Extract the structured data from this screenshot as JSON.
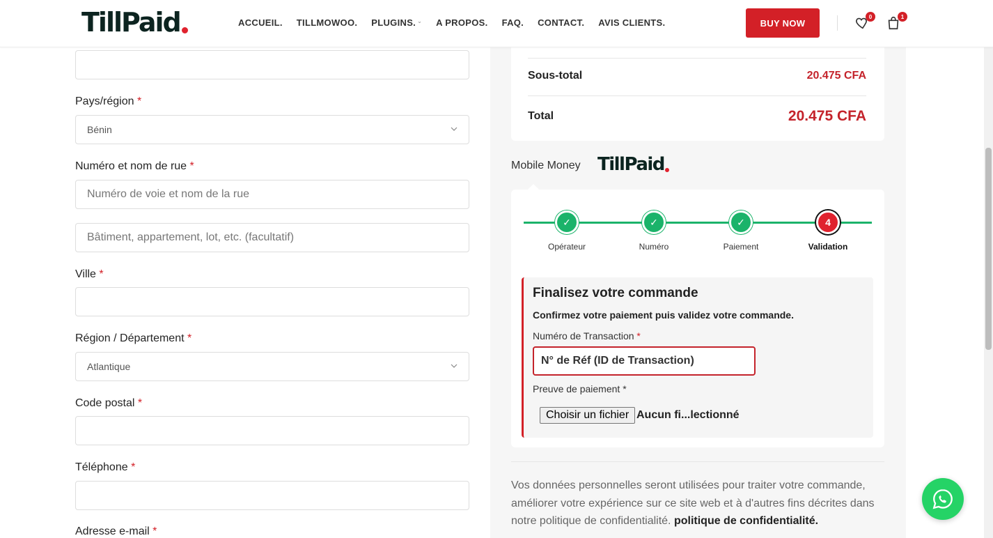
{
  "brand": {
    "logo_text": "TillPaid",
    "accent": "#d32027"
  },
  "nav": {
    "items": [
      "ACCUEIL.",
      "TILLMOWOO.",
      "PLUGINS.",
      "A PROPOS.",
      "FAQ.",
      "CONTACT.",
      "AVIS CLIENTS."
    ],
    "buy_label": "BUY NOW",
    "wishlist_count": "0",
    "cart_count": "1"
  },
  "form": {
    "country_label": "Pays/région",
    "country_value": "Bénin",
    "street_label": "Numéro et nom de rue",
    "street_placeholder": "Numéro de voie et nom de la rue",
    "street2_placeholder": "Bâtiment, appartement, lot, etc. (facultatif)",
    "city_label": "Ville",
    "region_label": "Région / Département",
    "region_value": "Atlantique",
    "postal_label": "Code postal",
    "phone_label": "Téléphone",
    "email_label": "Adresse e-mail",
    "required_mark": "*"
  },
  "summary": {
    "subtotal_label": "Sous-total",
    "subtotal_value": "20.475 CFA",
    "total_label": "Total",
    "total_value": "20.475 CFA"
  },
  "payment": {
    "method_label": "Mobile Money",
    "logo_text": "TillPaid",
    "steps": [
      {
        "label": "Opérateur",
        "mark": "✓"
      },
      {
        "label": "Numéro",
        "mark": "✓"
      },
      {
        "label": "Paiement",
        "mark": "✓"
      },
      {
        "label": "Validation",
        "mark": "4"
      }
    ],
    "final_title": "Finalisez votre commande",
    "final_subtitle": "Confirmez votre paiement puis validez votre commande.",
    "txn_label": "Numéro de Transaction",
    "txn_placeholder": "N° de Réf (ID de Transaction)",
    "proof_label": "Preuve de paiement *",
    "file_button": "Choisir un fichier",
    "file_status": "Aucun fi...lectionné"
  },
  "privacy": {
    "text": "Vos données personnelles seront utilisées pour traiter votre commande, améliorer votre expérience sur ce site web et à d'autres fins décrites dans notre politique de confidentialité.",
    "link": "politique de confidentialité."
  }
}
